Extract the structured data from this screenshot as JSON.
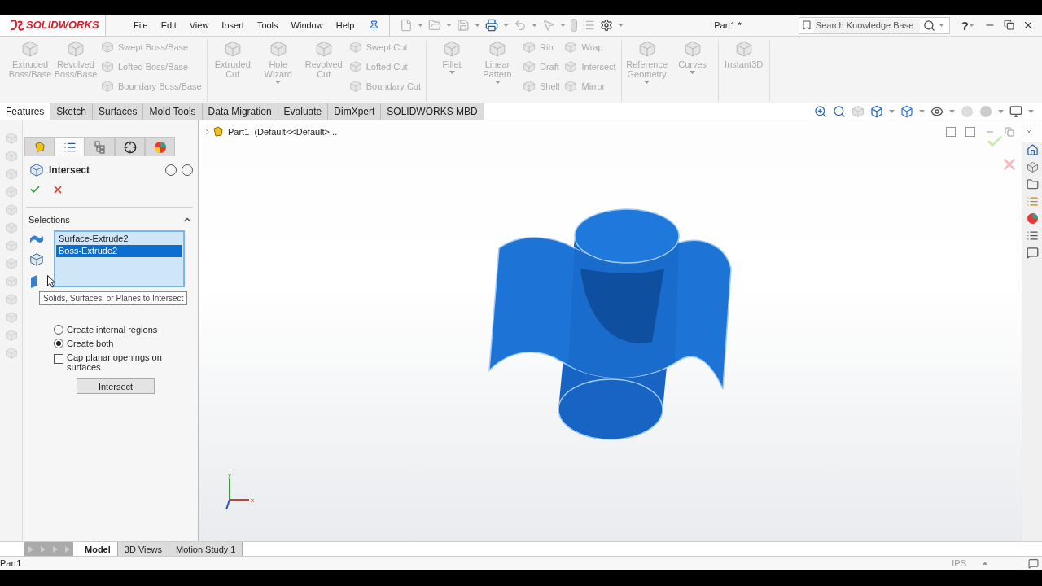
{
  "title_bar": {
    "logo": "SOLIDWORKS",
    "menus": [
      "File",
      "Edit",
      "View",
      "Insert",
      "Tools",
      "Window",
      "Help"
    ],
    "document_title": "Part1 *",
    "search": {
      "placeholder": "Search Knowledge Base"
    },
    "help": "?"
  },
  "ribbon": {
    "groups": [
      {
        "items": [
          {
            "kind": "large",
            "label": "Extruded Boss/Base",
            "disabled": true,
            "dropdown": false
          },
          {
            "kind": "large",
            "label": "Revolved Boss/Base",
            "disabled": true,
            "dropdown": false
          },
          {
            "kind": "stack",
            "items": [
              {
                "label": "Swept Boss/Base",
                "disabled": true
              },
              {
                "label": "Lofted Boss/Base",
                "disabled": true
              },
              {
                "label": "Boundary Boss/Base",
                "disabled": true
              }
            ]
          }
        ]
      },
      {
        "items": [
          {
            "kind": "large",
            "label": "Extruded Cut",
            "disabled": true,
            "dropdown": false
          },
          {
            "kind": "large",
            "label": "Hole Wizard",
            "disabled": true,
            "dropdown": true
          },
          {
            "kind": "large",
            "label": "Revolved Cut",
            "disabled": true,
            "dropdown": false
          },
          {
            "kind": "stack",
            "items": [
              {
                "label": "Swept Cut",
                "disabled": true
              },
              {
                "label": "Lofted Cut",
                "disabled": true
              },
              {
                "label": "Boundary Cut",
                "disabled": true
              }
            ]
          }
        ]
      },
      {
        "items": [
          {
            "kind": "large",
            "label": "Fillet",
            "disabled": true,
            "dropdown": true
          },
          {
            "kind": "large",
            "label": "Linear Pattern",
            "disabled": true,
            "dropdown": true
          },
          {
            "kind": "stack",
            "items": [
              {
                "label": "Rib",
                "disabled": true
              },
              {
                "label": "Draft",
                "disabled": true
              },
              {
                "label": "Shell",
                "disabled": true
              }
            ]
          },
          {
            "kind": "stack",
            "items": [
              {
                "label": "Wrap",
                "disabled": true
              },
              {
                "label": "Intersect",
                "disabled": true
              },
              {
                "label": "Mirror",
                "disabled": true
              }
            ]
          }
        ]
      },
      {
        "items": [
          {
            "kind": "large",
            "label": "Reference Geometry",
            "disabled": true,
            "dropdown": true
          },
          {
            "kind": "large",
            "label": "Curves",
            "disabled": true,
            "dropdown": true
          }
        ]
      },
      {
        "items": [
          {
            "kind": "large",
            "label": "Instant3D",
            "disabled": true,
            "dropdown": false
          }
        ]
      }
    ]
  },
  "command_tabs": [
    {
      "label": "Features",
      "selected": true
    },
    {
      "label": "Sketch",
      "selected": false
    },
    {
      "label": "Surfaces",
      "selected": false
    },
    {
      "label": "Mold Tools",
      "selected": false
    },
    {
      "label": "Data Migration",
      "selected": false
    },
    {
      "label": "Evaluate",
      "selected": false
    },
    {
      "label": "DimXpert",
      "selected": false
    },
    {
      "label": "SOLIDWORKS MBD",
      "selected": false
    }
  ],
  "property_manager": {
    "tabs": [
      {
        "kind": "feature_tree",
        "selected": false
      },
      {
        "kind": "property",
        "selected": true
      },
      {
        "kind": "configuration",
        "selected": false
      },
      {
        "kind": "dimxpert",
        "selected": false
      },
      {
        "kind": "display",
        "selected": false
      }
    ],
    "title": "Intersect",
    "selections": {
      "heading": "Selections",
      "expanded": true,
      "items": [
        {
          "label": "Surface-Extrude2",
          "selected": false
        },
        {
          "label": "Boss-Extrude2",
          "selected": true
        }
      ],
      "tooltip": "Solids, Surfaces, or Planes to Intersect"
    },
    "options": [
      {
        "kind": "radio",
        "label": "Create internal regions",
        "selected": false
      },
      {
        "kind": "radio",
        "label": "Create both",
        "selected": true
      },
      {
        "kind": "checkbox",
        "label": "Cap planar openings on surfaces",
        "checked": false
      }
    ],
    "action_button": "Intersect"
  },
  "graphics": {
    "tree_flyout": "Part1  (Default<<Default>...",
    "triad": {
      "y": "y",
      "x": "x"
    }
  },
  "bottom_tabs": [
    {
      "label": "Model",
      "selected": true
    },
    {
      "label": "3D Views",
      "selected": false
    },
    {
      "label": "Motion Study 1",
      "selected": false
    }
  ],
  "status_bar": {
    "document": "Part1",
    "units": "IPS"
  }
}
